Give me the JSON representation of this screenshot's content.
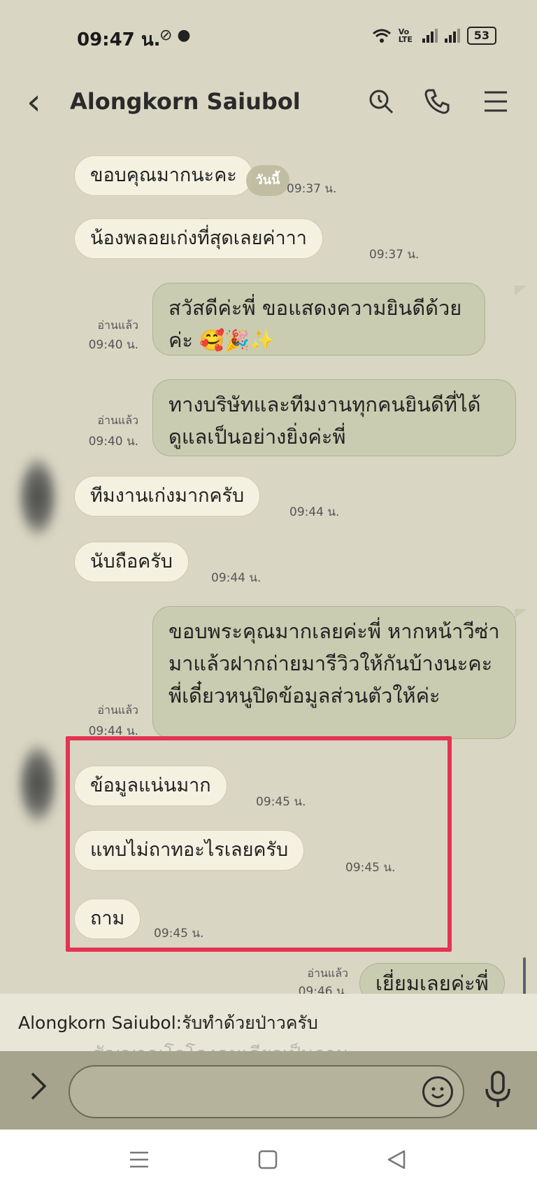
{
  "status_bar": {
    "time": "09:47 น.",
    "app_icons": "⊘ ●",
    "signal_label": "Vo LTE",
    "battery": "53"
  },
  "header": {
    "title": "Alongkorn Saiubol"
  },
  "today_chip": "วันนี้",
  "messages": [
    {
      "text": "ขอบคุณมากนะคะ",
      "time": "09:37 น."
    },
    {
      "text": "น้องพลอยเก่งที่สุดเลยค่าาา",
      "time": "09:37 น."
    },
    {
      "text": "สวัสดีค่ะพี่ ขอแสดงความยินดีด้วยค่ะ 🥰🎉✨",
      "read": "อ่านแล้ว",
      "time": "09:40 น."
    },
    {
      "text": "ทางบริษัทและทีมงานทุกคนยินดีที่ได้ดูแลเป็นอย่างยิ่งค่ะพี่",
      "read": "อ่านแล้ว",
      "time": "09:40 น."
    },
    {
      "text": "ทีมงานเก่งมากครับ",
      "time": "09:44 น."
    },
    {
      "text": "นับถือครับ",
      "time": "09:44 น."
    },
    {
      "text": "ขอบพระคุณมากเลยค่ะพี่ หากหน้าวีซ่ามาแล้วฝากถ่ายมารีวิวให้กันบ้างนะคะพี่เดี๋ยวหนูปิดข้อมูลส่วนตัวให้ค่ะ",
      "read": "อ่านแล้ว",
      "time": "09:44 น."
    },
    {
      "text": "ข้อมูลแน่นมาก",
      "time": "09:45 น."
    },
    {
      "text": "แทบไม่ถาทอะไรเลยครับ",
      "time": "09:45 น."
    },
    {
      "text": "ถาม",
      "time": "09:45 น."
    },
    {
      "text": "เยี่ยมเลยค่ะพี่",
      "read": "อ่านแล้ว",
      "time": "09:46 น."
    }
  ],
  "notification": {
    "text": "Alongkorn Saiubol:รับทำด้วยป่าวครับ",
    "ghost": "สัญญาณโอโลงคนเดียวเป็นถาม"
  },
  "composer": {
    "placeholder": ""
  },
  "colors": {
    "background": "#d9d6c3",
    "incoming_bubble": "#f4f1e1",
    "outgoing_bubble": "#c9ccb0",
    "highlight": "#e53353"
  }
}
